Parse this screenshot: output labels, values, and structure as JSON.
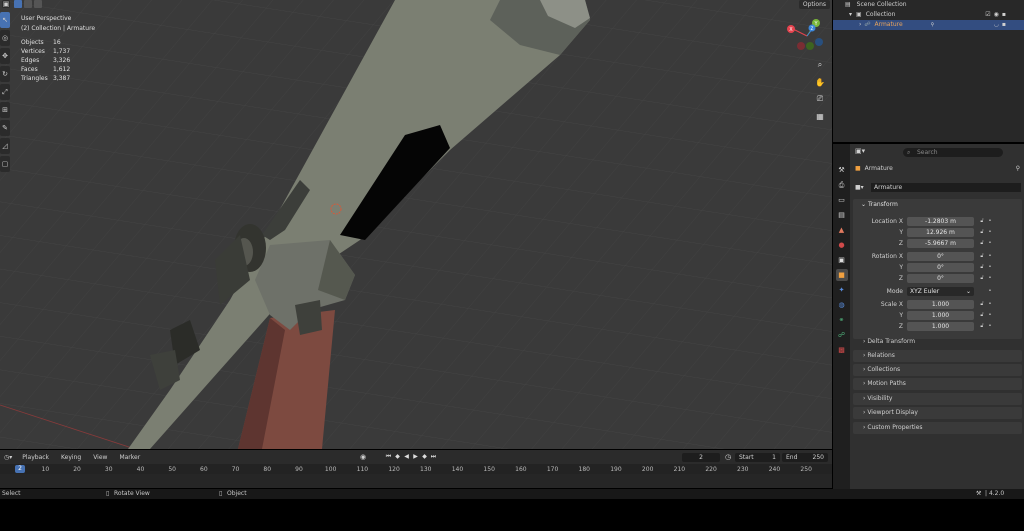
{
  "viewport": {
    "perspective_label": "User Perspective",
    "collection_label": "(2) Collection | Armature",
    "options_label": "Options",
    "stats": [
      {
        "label": "Objects",
        "value": "16"
      },
      {
        "label": "Vertices",
        "value": "1,737"
      },
      {
        "label": "Edges",
        "value": "3,326"
      },
      {
        "label": "Faces",
        "value": "1,612"
      },
      {
        "label": "Triangles",
        "value": "3,387"
      }
    ],
    "gizmo_axes": [
      "X",
      "Y",
      "Z"
    ]
  },
  "outliner": {
    "scene_collection": "Scene Collection",
    "collection": "Collection",
    "armature": "Armature"
  },
  "properties": {
    "search_placeholder": "Search",
    "object_name": "Armature",
    "data_name": "Armature",
    "transform_title": "Transform",
    "location_label": "Location X",
    "location": [
      "-1.2803 m",
      "12.926 m",
      "-5.9667 m"
    ],
    "rotation_label": "Rotation X",
    "rotation": [
      "0°",
      "0°",
      "0°"
    ],
    "mode_label": "Mode",
    "mode_value": "XYZ Euler",
    "scale_label": "Scale X",
    "scale": [
      "1.000",
      "1.000",
      "1.000"
    ],
    "y_label": "Y",
    "z_label": "Z",
    "delta_transform": "Delta Transform",
    "panels": [
      "Relations",
      "Collections",
      "Motion Paths",
      "Visibility",
      "Viewport Display",
      "Custom Properties"
    ]
  },
  "timeline": {
    "menus": [
      "Playback",
      "Keying",
      "View",
      "Marker"
    ],
    "current_frame": "2",
    "start_label": "Start",
    "start_value": "1",
    "end_label": "End",
    "end_value": "250",
    "ticks": [
      "10",
      "20",
      "30",
      "40",
      "50",
      "60",
      "70",
      "80",
      "90",
      "100",
      "110",
      "120",
      "130",
      "140",
      "150",
      "160",
      "170",
      "180",
      "190",
      "200",
      "210",
      "220",
      "230",
      "240",
      "250"
    ]
  },
  "statusbar": {
    "select": "Select",
    "rotate_view": "Rotate View",
    "object": "Object",
    "version": "4.2.0"
  },
  "colors": {
    "accent": "#4772b3",
    "viewport_bg": "#3a3a3a",
    "x_axis": "#e5434e",
    "y_axis": "#7ab639",
    "z_axis": "#3d86d8"
  }
}
